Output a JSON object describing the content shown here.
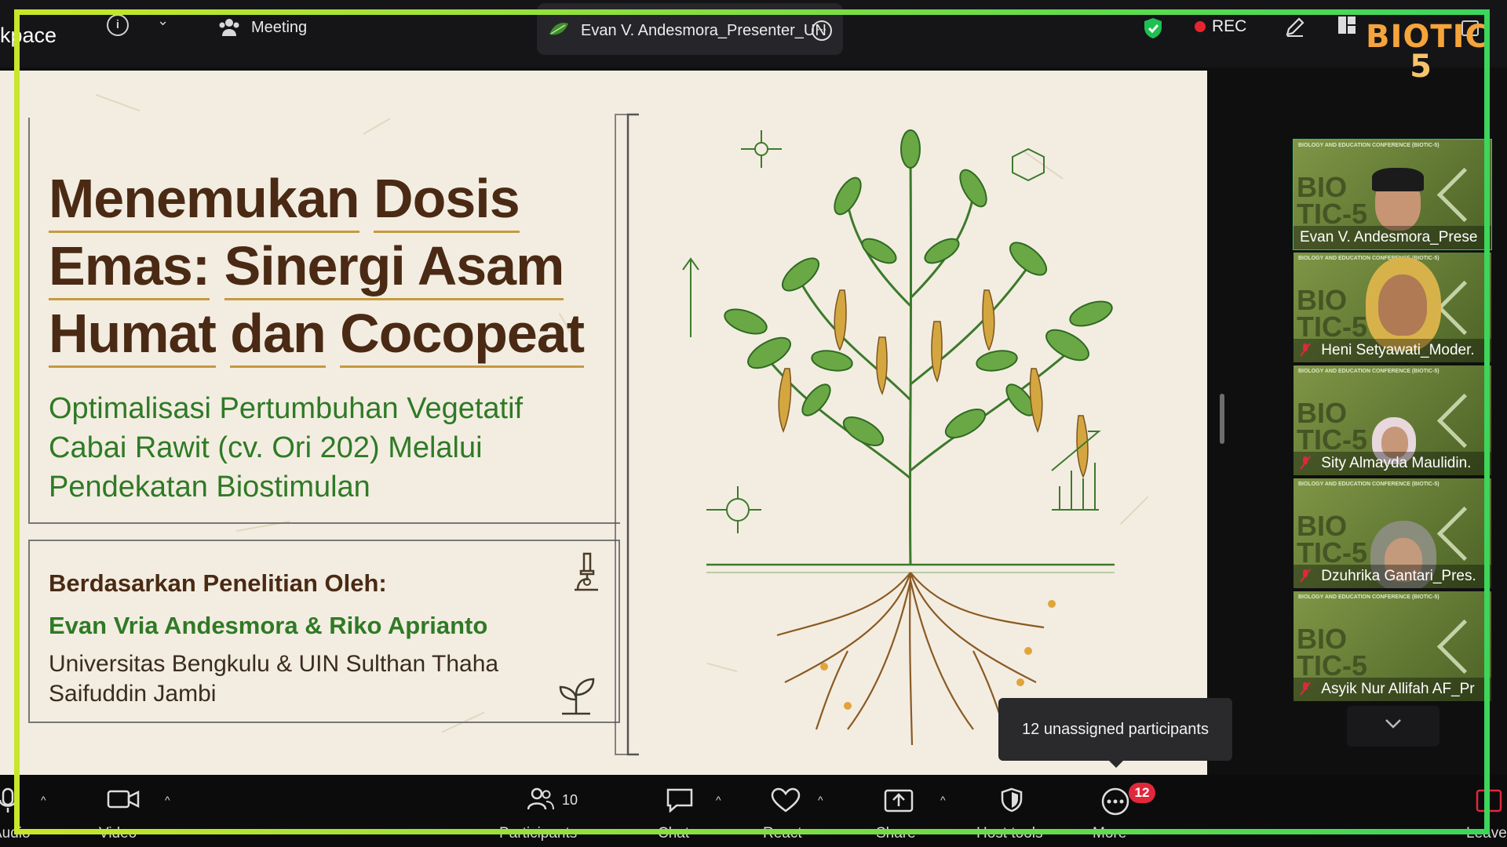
{
  "topbar": {
    "app_name": "kpace",
    "meeting_label": "Meeting",
    "speaker_name": "Evan V. Andesmora_Presenter_UN",
    "rec_label": "REC"
  },
  "logo": {
    "line1": "BIOTIC",
    "line2": "5",
    "color_primary": "#f5a43a"
  },
  "slide": {
    "title_line1_a": "Menemukan",
    "title_line1_b": "Dosis",
    "title_line2_a": "Emas:",
    "title_line2_b": "Sinergi Asam",
    "title_line3_a": "Humat",
    "title_line3_b": "dan",
    "title_line3_c": "Cocopeat",
    "subtitle_1": "Optimalisasi Pertumbuhan Vegetatif",
    "subtitle_2": "Cabai Rawit (cv. Ori 202) Melalui",
    "subtitle_3": "Pendekatan Biostimulan",
    "research_heading": "Berdasarkan Penelitian Oleh:",
    "authors": "Evan Vria Andesmora & Riko Aprianto",
    "affiliation_1": "Universitas Bengkulu & UIN Sulthan Thaha",
    "affiliation_2": "Saifuddin Jambi",
    "title_color": "#4a2a14",
    "subtitle_color": "#2f7a26"
  },
  "gallery": {
    "tiles": [
      {
        "name": "Evan V. Andesmora_Prese",
        "muted": false,
        "active": true
      },
      {
        "name": "Heni Setyawati_Moder.",
        "muted": true,
        "active": false
      },
      {
        "name": "Sity Almayda Maulidin.",
        "muted": true,
        "active": false
      },
      {
        "name": "Dzuhrika Gantari_Pres.",
        "muted": true,
        "active": false
      },
      {
        "name": "Asyik Nur Allifah AF_Pr",
        "muted": true,
        "active": false
      }
    ],
    "tile_header": "BIOLOGY AND EDUCATION CONFERENCE (BIOTIC-5)",
    "tile_bio_text_1": "BIO",
    "tile_bio_text_2": "TIC-5"
  },
  "tooltip": {
    "text": "12 unassigned participants"
  },
  "toolbar": {
    "audio_label": "Audio",
    "video_label": "Video",
    "participants_label": "Participants",
    "participants_count": "10",
    "chat_label": "Chat",
    "react_label": "React",
    "share_label": "Share",
    "host_tools_label": "Host tools",
    "more_label": "More",
    "more_badge": "12",
    "leave_label": "Leave"
  },
  "colors": {
    "frame_green": "#3cd65a",
    "frame_yellow": "#c8e62a",
    "rec_red": "#e8232e",
    "active_tile": "#23d160"
  }
}
